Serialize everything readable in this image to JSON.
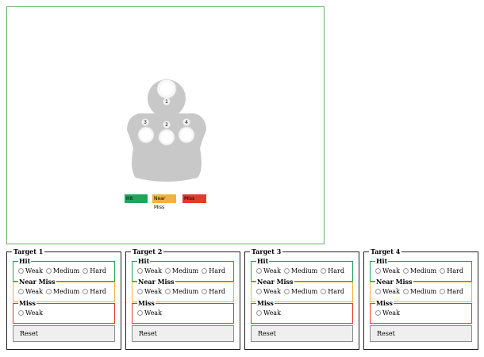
{
  "figure": {
    "zones": [
      {
        "number": "1"
      },
      {
        "number": "2"
      },
      {
        "number": "3"
      },
      {
        "number": "4"
      }
    ],
    "legend": [
      {
        "label": "Hit",
        "color": "#1ea65a"
      },
      {
        "label": "Near Miss",
        "color": "#f0b43c"
      },
      {
        "label": "Miss",
        "color": "#e23b2e"
      }
    ],
    "body_color": "#c8c8c8",
    "zone_fill": "#f7f7f7"
  },
  "targets": [
    {
      "title": "Target 1",
      "hit": {
        "legend": "Hit",
        "options": [
          "Weak",
          "Medium",
          "Hard"
        ]
      },
      "near": {
        "legend": "Near Miss",
        "options": [
          "Weak",
          "Medium",
          "Hard"
        ]
      },
      "miss": {
        "legend": "Miss",
        "options": [
          "Weak"
        ]
      },
      "reset_label": "Reset"
    },
    {
      "title": "Target 2",
      "hit": {
        "legend": "Hit",
        "options": [
          "Weak",
          "Medium",
          "Hard"
        ]
      },
      "near": {
        "legend": "Near Miss",
        "options": [
          "Weak",
          "Medium",
          "Hard"
        ]
      },
      "miss": {
        "legend": "Miss",
        "options": [
          "Weak"
        ]
      },
      "reset_label": "Reset"
    },
    {
      "title": "Target 3",
      "hit": {
        "legend": "Hit",
        "options": [
          "Weak",
          "Medium",
          "Hard"
        ]
      },
      "near": {
        "legend": "Near Miss",
        "options": [
          "Weak",
          "Medium",
          "Hard"
        ]
      },
      "miss": {
        "legend": "Miss",
        "options": [
          "Weak"
        ]
      },
      "reset_label": "Reset"
    },
    {
      "title": "Target 4",
      "hit": {
        "legend": "Hit",
        "options": [
          "Weak",
          "Medium",
          "Hard"
        ]
      },
      "near": {
        "legend": "Near Miss",
        "options": [
          "Weak",
          "Medium",
          "Hard"
        ]
      },
      "miss": {
        "legend": "Miss",
        "options": [
          "Weak"
        ]
      },
      "reset_label": "Reset"
    }
  ]
}
